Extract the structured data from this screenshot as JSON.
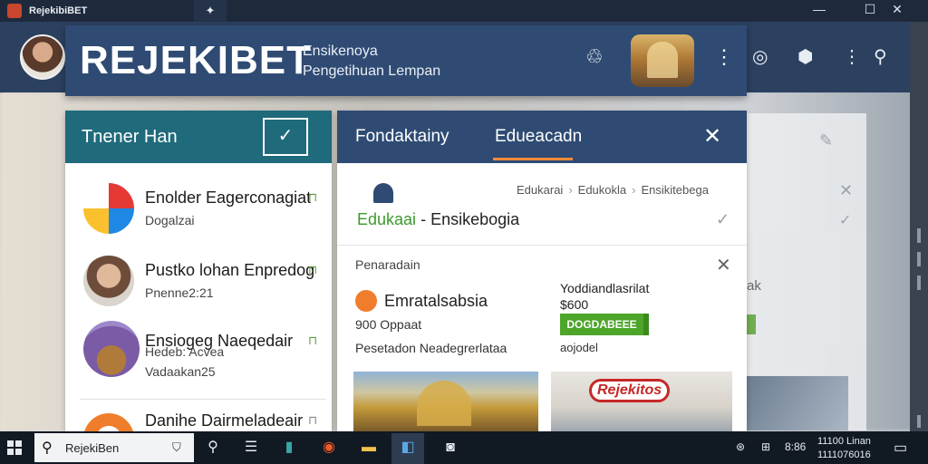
{
  "window": {
    "title": "RejekibiBET",
    "pin_glyph": "✦",
    "controls": [
      "—",
      "☐",
      "✕"
    ]
  },
  "header": {
    "brand": "REJEKIBET",
    "subtitle_line1": "Ensikenoya",
    "subtitle_line2": "Pengetihuan Lempan"
  },
  "left_panel": {
    "title": "Tnener Han",
    "edit_glyph": "✓",
    "items": [
      {
        "name": "Enolder Eagerconagiat",
        "sub": "Dogalzai",
        "sub2": "",
        "lock": "⊓"
      },
      {
        "name": "Pustko lohan Enpredog",
        "sub": "Pnenne2:21",
        "sub2": "",
        "lock": "⊓"
      },
      {
        "name": "Ensiogeg Naeqedair",
        "sub": "Hedeb: Acvea",
        "sub2": "Vadaakan25",
        "lock": "⊓"
      },
      {
        "name": "Danihe Dairmeladeair",
        "sub": "",
        "sub2": "",
        "lock": "⊓"
      }
    ]
  },
  "mid_panel": {
    "tabs": [
      "Fondaktainy",
      "Edueacadn"
    ],
    "close_glyph": "✕",
    "breadcrumbs": [
      "Edukarai",
      "Edukokla",
      "Ensikitebega"
    ],
    "section_accent": "Edukaai",
    "section_rest": "- Ensikebogia",
    "check_glyph": "✓",
    "sub_label": "Penaradain",
    "sub_close": "✕",
    "row_title": "Emratalsabsia",
    "row_meta": "900  Oppaat",
    "row_desc": "Pesetadon Neadegrerlataa",
    "right_title": "Yoddiandlasrilat",
    "right_price": "$600",
    "green_button": "DOGDABEEE",
    "right_sub": "aojodel",
    "photo2_sign": "Rejekitos"
  },
  "taskbar": {
    "search_text": "RejekiBen",
    "search_icon": "search-icon",
    "tray_1": "⊞",
    "tray_2": "8:86",
    "clock_line1": "11100 Linan",
    "clock_line2": "1111076016"
  },
  "colors": {
    "header": "#2f4b73",
    "left_head": "#1f6a7b",
    "accent_orange": "#f08a3c",
    "accent_green": "#4da52a",
    "taskbar": "#111923"
  }
}
